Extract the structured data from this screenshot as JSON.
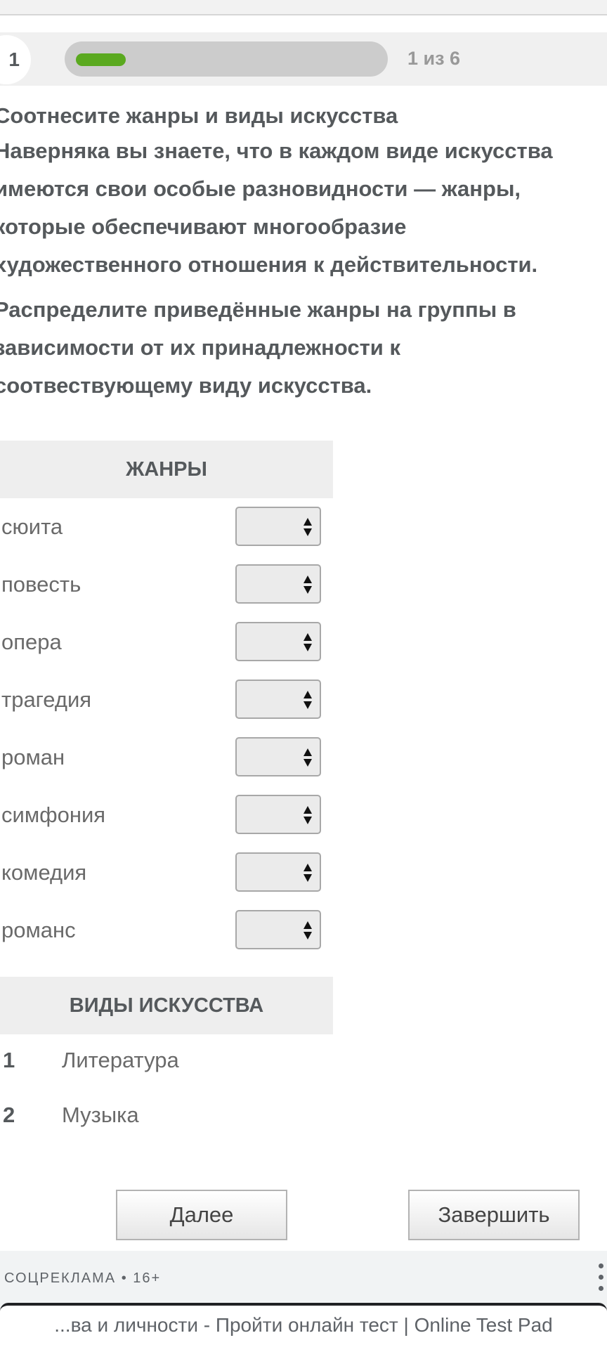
{
  "progress": {
    "question_number": "1",
    "counter": "1 из 6",
    "fraction": 0.1667,
    "bar_color": "#5aa91f"
  },
  "question": {
    "title": "Соотнесите жанры и виды искусства",
    "paragraph1": "Наверняка вы знаете, что в каждом виде искусства имеются свои особые разновидности — жанры, которые обеспечивают многообразие художественного отношения к действительности.",
    "paragraph2": "Распределите приведённые жанры на группы в зависимости от их принадлежности к соотвествующему виду искусства."
  },
  "genres": {
    "header": "ЖАНРЫ",
    "items": [
      {
        "label": "сюита",
        "value": ""
      },
      {
        "label": "повесть",
        "value": ""
      },
      {
        "label": "опера",
        "value": ""
      },
      {
        "label": "трагедия",
        "value": ""
      },
      {
        "label": "роман",
        "value": ""
      },
      {
        "label": "симфония",
        "value": ""
      },
      {
        "label": "комедия",
        "value": ""
      },
      {
        "label": "романс",
        "value": ""
      }
    ]
  },
  "arts": {
    "header": "ВИДЫ ИСКУССТВА",
    "items": [
      {
        "num": "1",
        "label": "Литература"
      },
      {
        "num": "2",
        "label": "Музыка"
      }
    ]
  },
  "buttons": {
    "next": "Далее",
    "finish": "Завершить"
  },
  "ad": {
    "label": "СОЦРЕКЛАМА • 16+",
    "text": "...ва и личности - Пройти онлайн тест | Online Test Pad"
  }
}
